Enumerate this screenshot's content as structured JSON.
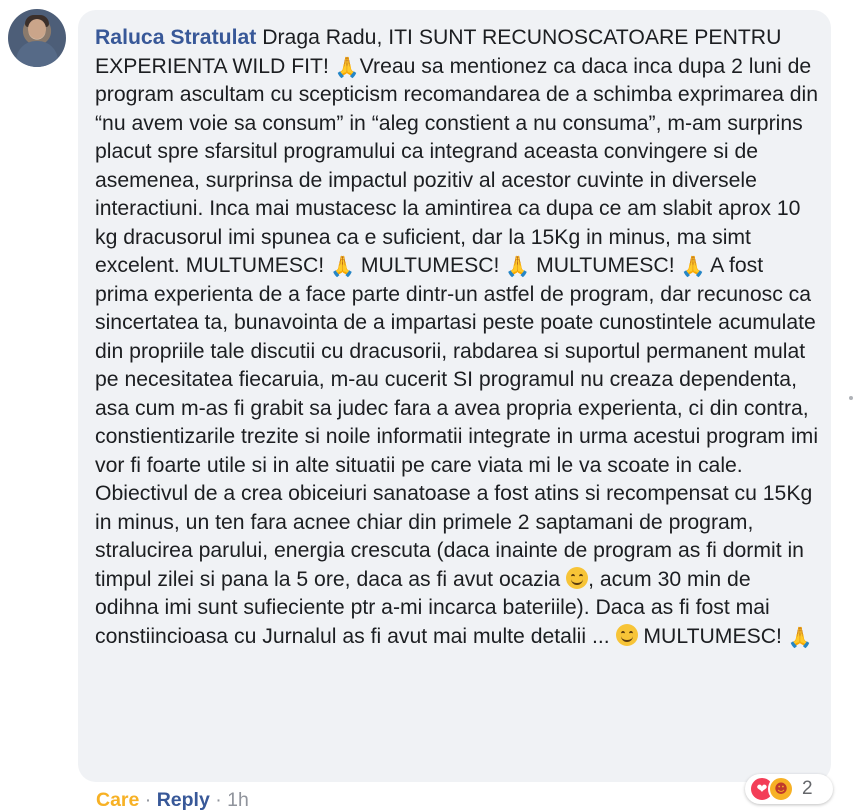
{
  "comment": {
    "author": "Raluca Stratulat",
    "segments": [
      {
        "type": "text",
        "value": "Draga Radu, ITI SUNT RECUNOSCATOARE PENTRU EXPERIENTA WILD FIT! "
      },
      {
        "type": "emoji",
        "name": "folded-hands",
        "glyph": "🙏"
      },
      {
        "type": "text",
        "value": "Vreau sa mentionez ca daca inca dupa 2 luni de program ascultam cu scepticism recomandarea de a schimba exprimarea din “nu avem voie sa consum” in “aleg constient a nu consuma”, m-am surprins placut spre sfarsitul programului ca integrand aceasta convingere si de asemenea, surprinsa de impactul pozitiv al acestor cuvinte in diversele interactiuni. Inca mai mustacesc la amintirea ca dupa ce am slabit aprox 10 kg dracusorul imi spunea ca e suficient, dar la 15Kg in minus, ma simt excelent. MULTUMESC! "
      },
      {
        "type": "emoji",
        "name": "folded-hands",
        "glyph": "🙏"
      },
      {
        "type": "text",
        "value": " MULTUMESC! "
      },
      {
        "type": "emoji",
        "name": "folded-hands",
        "glyph": "🙏"
      },
      {
        "type": "text",
        "value": " MULTUMESC! "
      },
      {
        "type": "emoji",
        "name": "folded-hands",
        "glyph": "🙏"
      },
      {
        "type": "text",
        "value": " A fost prima experienta de a face parte dintr-un astfel de program, dar recunosc ca sincertatea ta, bunavointa de a impartasi peste poate cunostintele acumulate din propriile tale discutii cu dracusorii, rabdarea si suportul permanent mulat pe necesitatea fiecaruia, m-au cucerit SI programul nu creaza dependenta, asa cum m-as fi grabit sa judec fara a avea propria experienta, ci din contra, constientizarile trezite si noile informatii integrate in urma acestui program imi vor fi foarte utile si in alte situatii pe care viata mi le va scoate in cale. Obiectivul de a crea obiceiuri sanatoase a fost atins si recompensat cu 15Kg in minus, un ten fara acnee chiar din primele 2 saptamani de program, stralucirea parului, energia crescuta (daca inainte de program as fi dormit in timpul zilei si pana la 5 ore, daca as fi avut ocazia "
      },
      {
        "type": "emoji",
        "name": "smiling-face",
        "glyph": "😊"
      },
      {
        "type": "text",
        "value": ", acum 30 min de odihna imi sunt sufieciente ptr a-mi incarca bateriile). Daca as fi fost mai constiincioasa cu Jurnalul as fi avut mai multe detalii ... "
      },
      {
        "type": "emoji",
        "name": "smiling-face",
        "glyph": "😊"
      },
      {
        "type": "text",
        "value": " MULTUMESC! "
      },
      {
        "type": "emoji",
        "name": "folded-hands",
        "glyph": "🙏"
      }
    ]
  },
  "actions": {
    "care_label": "Care",
    "separator": "·",
    "reply_label": "Reply",
    "time": "1h"
  },
  "reactions": {
    "icons": [
      "love-icon",
      "care-icon"
    ],
    "count": "2"
  },
  "colors": {
    "bubble_bg": "#f0f2f5",
    "author": "#385898",
    "care": "#f7b125",
    "love": "#f33e58"
  }
}
